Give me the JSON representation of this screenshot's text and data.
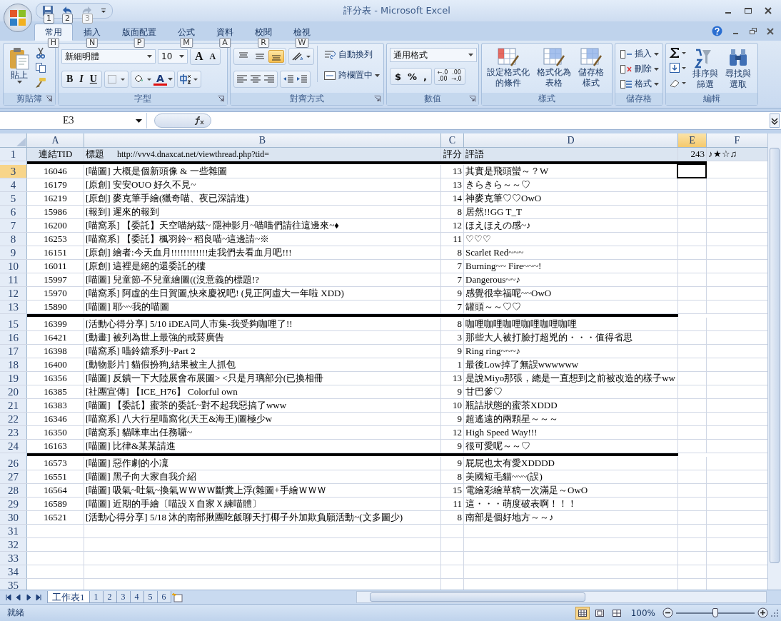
{
  "window": {
    "title": "評分表 - Microsoft Excel"
  },
  "quick_access": {
    "keytips": [
      "1",
      "2",
      "3"
    ]
  },
  "tabs": [
    {
      "label": "常用",
      "keytip": "H",
      "selected": true
    },
    {
      "label": "插入",
      "keytip": "N",
      "selected": false
    },
    {
      "label": "版面配置",
      "keytip": "P",
      "selected": false
    },
    {
      "label": "公式",
      "keytip": "M",
      "selected": false
    },
    {
      "label": "資料",
      "keytip": "A",
      "selected": false
    },
    {
      "label": "校閱",
      "keytip": "R",
      "selected": false
    },
    {
      "label": "檢視",
      "keytip": "W",
      "selected": false
    }
  ],
  "ribbon": {
    "groups": [
      {
        "kind": "clipboard",
        "label": "剪貼簿",
        "launcher": true,
        "paste": "貼上"
      },
      {
        "kind": "font",
        "label": "字型",
        "launcher": true,
        "font_name": "新細明體",
        "font_size": "10",
        "grow": "A",
        "shrink": "A",
        "styles": [
          "B",
          "I",
          "U"
        ],
        "font_color": "A"
      },
      {
        "kind": "alignment",
        "label": "對齊方式",
        "launcher": true,
        "vertical": [
          {
            "selected": false
          },
          {
            "selected": false
          },
          {
            "selected": true
          }
        ],
        "wrap": "自動換列",
        "merge": "跨欄置中"
      },
      {
        "kind": "number",
        "label": "數值",
        "launcher": true,
        "format": "通用格式",
        "symbols": [
          "$",
          "%",
          ","
        ],
        "decimals": [
          [
            "←.0",
            ".00"
          ],
          [
            ".00",
            "→.0"
          ]
        ]
      },
      {
        "kind": "styles",
        "label": "樣式",
        "launcher": false,
        "buttons": [
          [
            "設定格式化",
            "的條件"
          ],
          [
            "格式化為",
            "表格"
          ],
          [
            "儲存格",
            "樣式"
          ]
        ]
      },
      {
        "kind": "cells",
        "label": "儲存格",
        "launcher": false,
        "buttons": [
          "插入",
          "刪除",
          "格式"
        ]
      },
      {
        "kind": "editing",
        "label": "編輯",
        "launcher": false,
        "buttons": [
          [
            "排序與",
            "篩選"
          ],
          [
            "尋找與",
            "選取"
          ]
        ]
      }
    ]
  },
  "formula_bar": {
    "name_box": "E3"
  },
  "columns": [
    {
      "label": "A",
      "selected": false
    },
    {
      "label": "B",
      "selected": false
    },
    {
      "label": "C",
      "selected": false
    },
    {
      "label": "D",
      "selected": false
    },
    {
      "label": "E",
      "selected": true
    },
    {
      "label": "F",
      "selected": false
    }
  ],
  "rows": [
    {
      "kind": "header",
      "number": "1",
      "cells": [
        "連結TID",
        "標題",
        "評分",
        "評語",
        "243",
        "♪★☆♫"
      ],
      "url": "http://vvv4.dnaxcat.net/viewthread.php?tid="
    },
    {
      "kind": "separator",
      "wide": true
    },
    {
      "kind": "data",
      "number": "3",
      "selected": true,
      "cells": [
        "16046",
        "[喵圖] 大概是個新頭像 & 一些雜圖",
        "13",
        "其實是飛頭蠻～？W"
      ]
    },
    {
      "kind": "data",
      "number": "4",
      "selected": false,
      "cells": [
        "16179",
        "[原創] 安安OUO 好久不見~",
        "13",
        "きらきら～～♡"
      ]
    },
    {
      "kind": "data",
      "number": "5",
      "selected": false,
      "cells": [
        "16219",
        "[原創] 麥克筆手繪(獵奇喵、夜已深請進)",
        "14",
        "神麥克筆♡♡OwO"
      ]
    },
    {
      "kind": "data",
      "number": "6",
      "selected": false,
      "cells": [
        "15986",
        "[報到] 遲來的報到",
        "8",
        "居然!!GG T_T"
      ]
    },
    {
      "kind": "data",
      "number": "7",
      "selected": false,
      "cells": [
        "16200",
        "[喵窩系] 【委託】天空喵納茲~ 隱神影月~喵喵們請往這邊來~♦",
        "12",
        "ほえほえの感~♪"
      ]
    },
    {
      "kind": "data",
      "number": "8",
      "selected": false,
      "cells": [
        "16253",
        "[喵窩系] 【委託】楓羽鈴~ 稻良喵~這邊請~※",
        "11",
        "♡♡♡"
      ]
    },
    {
      "kind": "data",
      "number": "9",
      "selected": false,
      "cells": [
        "16151",
        "[原創] 繪者:今天血月!!!!!!!!!!!!走我們去看血月吧!!!",
        "8",
        "Scarlet Red~~~"
      ]
    },
    {
      "kind": "data",
      "number": "10",
      "selected": false,
      "cells": [
        "16011",
        "[原創] 這裡是絕的還委託的樓",
        "7",
        "Burning~~ Fire~~~!"
      ]
    },
    {
      "kind": "data",
      "number": "11",
      "selected": false,
      "cells": [
        "15997",
        "[喵圖] 兒童節-不兒童繪圖((沒意義的標題!?",
        "7",
        "Dangerous~~♪"
      ]
    },
    {
      "kind": "data",
      "number": "12",
      "selected": false,
      "cells": [
        "15970",
        "[喵窩系] 阿虛的生日賀圖,快來慶祝吧! (見正阿虛大一年啦 XDD)",
        "9",
        "感覺很幸福呢~~OwO"
      ]
    },
    {
      "kind": "data",
      "number": "13",
      "selected": false,
      "cells": [
        "15890",
        "[喵圖] 耶~~我的喵圖",
        "7",
        "罐頭～～♡♡"
      ]
    },
    {
      "kind": "separator",
      "wide": false
    },
    {
      "kind": "data",
      "number": "15",
      "selected": false,
      "cells": [
        "16399",
        "[活動心得分享] 5/10 iDEA同人市集-我受夠咖哩了!!",
        "8",
        "咖哩咖哩咖哩咖哩咖哩咖哩"
      ]
    },
    {
      "kind": "data",
      "number": "16",
      "selected": false,
      "cells": [
        "16421",
        "[動畫] 被列為世上最強的戒菸廣告",
        "3",
        "那些大人被打臉打超兇的・・・值得省思"
      ]
    },
    {
      "kind": "data",
      "number": "17",
      "selected": false,
      "cells": [
        "16398",
        "[喵窩系] 喵鈴鐺系列~Part 2",
        "9",
        "Ring ring~~~♪"
      ]
    },
    {
      "kind": "data",
      "number": "18",
      "selected": false,
      "cells": [
        "16400",
        "[動物影片] 貓假扮狗,結果被主人抓包",
        "1",
        "最後Low掉了無誤wwwwww"
      ]
    },
    {
      "kind": "data",
      "number": "19",
      "selected": false,
      "cells": [
        "16356",
        "[喵圖] 反饋一下大陸展會布展圖> <只是月璃部分(已換相冊",
        "13",
        "是說Miyo那張，總是一直想到之前被改造的樣子ww"
      ]
    },
    {
      "kind": "data",
      "number": "20",
      "selected": false,
      "cells": [
        "16385",
        "[社團宣傳] 【ICE_H76】 Colorful own",
        "9",
        "甘巴爹♡"
      ]
    },
    {
      "kind": "data",
      "number": "21",
      "selected": false,
      "cells": [
        "16383",
        "[喵圖] 【委託】蜜茶的委託~對不起我惡搞了www",
        "10",
        "瓶詰狀態的蜜茶XDDD"
      ]
    },
    {
      "kind": "data",
      "number": "22",
      "selected": false,
      "cells": [
        "16346",
        "[喵窩系] 八大行星喵窩化(天王&海王)圖極少w",
        "9",
        "超遙遠的兩顆星～～～"
      ]
    },
    {
      "kind": "data",
      "number": "23",
      "selected": false,
      "cells": [
        "16350",
        "[喵窩系] 貓咪車出任務囉~",
        "12",
        "High Speed Way!!!"
      ]
    },
    {
      "kind": "data",
      "number": "24",
      "selected": false,
      "cells": [
        "16163",
        "[喵圖] 比律&某某請進",
        "9",
        "很可愛呢～～♡"
      ]
    },
    {
      "kind": "separator",
      "wide": false
    },
    {
      "kind": "data",
      "number": "26",
      "selected": false,
      "cells": [
        "16573",
        "[喵圖] 惡作劇的小凜",
        "9",
        "屁屁也太有愛XDDDD"
      ]
    },
    {
      "kind": "data",
      "number": "27",
      "selected": false,
      "cells": [
        "16551",
        "[喵圖] 黑子向大家自我介紹",
        "8",
        "美國短毛貓~~~(誤)"
      ]
    },
    {
      "kind": "data",
      "number": "28",
      "selected": false,
      "cells": [
        "16564",
        "[喵圖] 吸氣~吐氣~換氣ＷＷＷＷ斷糞上浮(雜圖+手繪ＷＷＷ",
        "15",
        "電繪彩繪草稿一次滿足～OwO"
      ]
    },
    {
      "kind": "data",
      "number": "29",
      "selected": false,
      "cells": [
        "16589",
        "[喵圖] 近期的手繪〔喵設Ｘ自家Ｘ練喵體〕",
        "11",
        "這・・・萌度破表啊！！！"
      ]
    },
    {
      "kind": "data",
      "number": "30",
      "selected": false,
      "cells": [
        "16521",
        "[活動心得分享] 5/18 沐的南部揪團吃飯聊天打椰子外加欺負願活動~(文多圖少)",
        "8",
        "南部是個好地方～～♪"
      ]
    },
    {
      "kind": "empty",
      "number": "31",
      "selected": false
    },
    {
      "kind": "empty",
      "number": "32",
      "selected": false
    },
    {
      "kind": "empty",
      "number": "33",
      "selected": false
    },
    {
      "kind": "empty",
      "number": "34",
      "selected": false
    },
    {
      "kind": "empty",
      "number": "35",
      "selected": false
    }
  ],
  "sheet_tabs": [
    {
      "label": "工作表1",
      "selected": true
    },
    {
      "label": "1",
      "selected": false
    },
    {
      "label": "2",
      "selected": false
    },
    {
      "label": "3",
      "selected": false
    },
    {
      "label": "4",
      "selected": false
    },
    {
      "label": "5",
      "selected": false
    },
    {
      "label": "6",
      "selected": false
    }
  ],
  "status_bar": {
    "status": "就緒",
    "views": [
      {
        "kind": "normal",
        "selected": true
      },
      {
        "kind": "layout",
        "selected": false
      },
      {
        "kind": "break",
        "selected": false
      }
    ],
    "zoom": "100%",
    "zoom_slider": {
      "level": 0.5
    }
  }
}
